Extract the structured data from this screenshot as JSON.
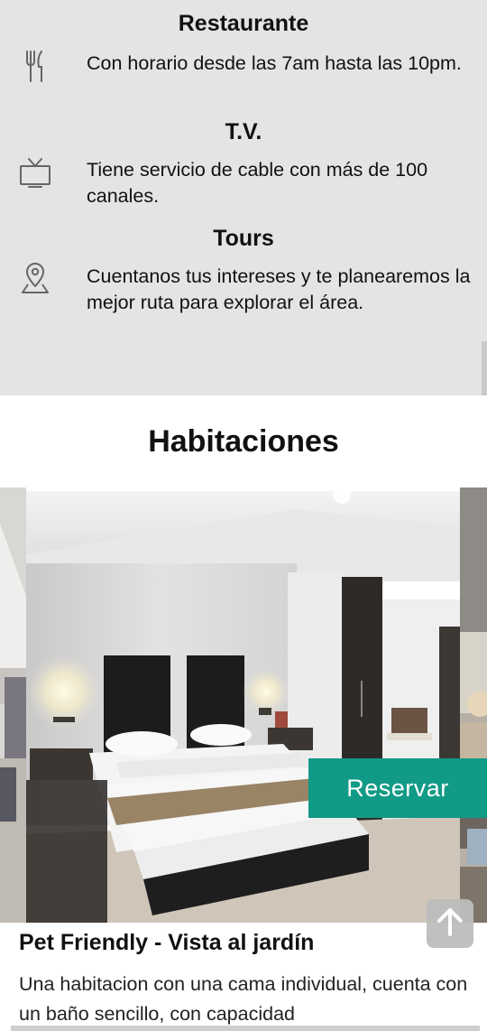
{
  "amenities": [
    {
      "title": "Restaurante",
      "icon": "fork-knife-icon",
      "text": "Con horario desde las 7am hasta las 10pm."
    },
    {
      "title": "T.V.",
      "icon": "tv-icon",
      "text": "Tiene servicio de cable con más de 100 canales."
    },
    {
      "title": "Tours",
      "icon": "map-pin-icon",
      "text": "Cuentanos tus intereses y te planearemos la mejor ruta para explorar el área."
    }
  ],
  "rooms_section": {
    "title": "Habitaciones",
    "reserve_label": "Reservar",
    "room_title": "Pet Friendly - Vista al jardín",
    "room_description": "Una habitacion con una cama individual, cuenta con un baño sencillo, con capacidad"
  },
  "colors": {
    "amenities_bg": "#e4e4e4",
    "accent": "#119a86",
    "scroll_top_bg": "#bdbdbd"
  }
}
